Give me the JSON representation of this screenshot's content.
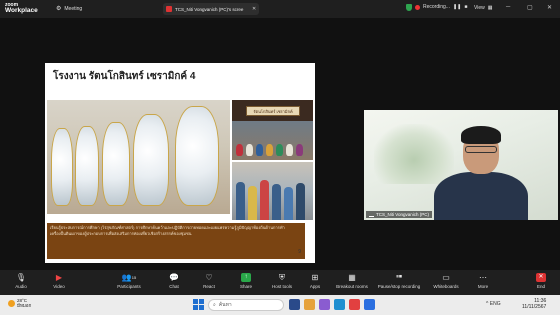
{
  "app": {
    "brand_top": "zoom",
    "brand_bottom": "Workplace"
  },
  "topbar": {
    "meeting_label": "Meeting",
    "share_title": "TCS_Niti Vongvanich (PC)'s scree",
    "recording_label": "Recording...",
    "view_label": "View"
  },
  "slide": {
    "title": "โรงงาน รัตนโกสินทร์ เซรามิกค์ 4",
    "sign_text": "รัตนโกสินทร์ เซรามิกค์",
    "caption": "เรียนรู้ประสบการณ์การศึกษา (ไร่สุขภัณฑ์ศาสตร์) การศึกษาค้นคว้าและปฏิบัติการถ่ายทอดและเผยแพร่ความรู้ภูมิปัญญาท้องถิ่นด้านการทำเครื่องปั้นดินเผาของผู้ประกอบการเพื่อส่งเสริมการท่องเที่ยวเชิงสร้างสรรค์ของชุมชน",
    "page_number": "9"
  },
  "participant": {
    "name": "TCS_Niti Vongvanich (PC)"
  },
  "toolbar": {
    "audio": "Audio",
    "video": "Video",
    "participants": "Participants",
    "participants_count": "15",
    "chat": "Chat",
    "react": "React",
    "share": "Share",
    "host_tools": "Host tools",
    "apps": "Apps",
    "breakout": "Breakout rooms",
    "pause_rec": "Pause/stop recording",
    "whiteboards": "Whiteboards",
    "more": "More",
    "end": "End"
  },
  "taskbar": {
    "temp": "28°C",
    "weather": "มีหมอก",
    "search_placeholder": "ค้นหา",
    "time": "11:36",
    "date": "11/11/2567",
    "lang": "ENG"
  },
  "colors": {
    "accent": "#2aa84a",
    "end": "#dd3333",
    "caption_bg": "#7a4412"
  }
}
